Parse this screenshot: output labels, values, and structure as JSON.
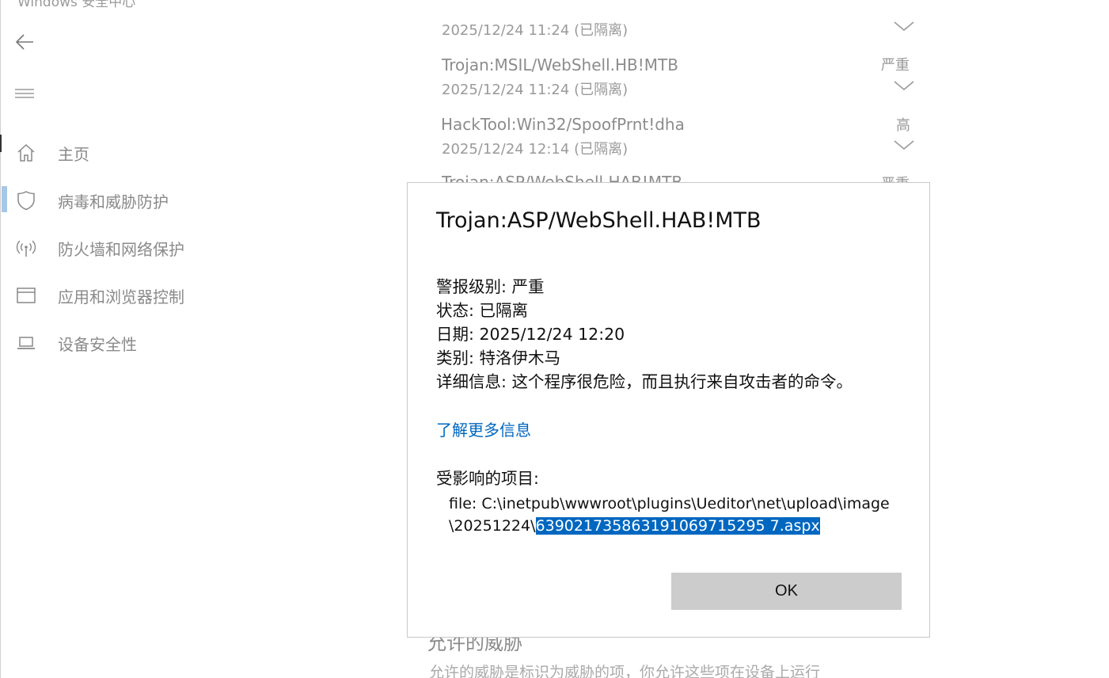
{
  "app": {
    "title": "Windows 安全中心"
  },
  "sidebar": {
    "items": [
      {
        "label": "主页",
        "icon": "home-icon"
      },
      {
        "label": "病毒和威胁防护",
        "icon": "shield-icon",
        "active": true
      },
      {
        "label": "防火墙和网络保护",
        "icon": "wireless-icon"
      },
      {
        "label": "应用和浏览器控制",
        "icon": "browser-window-icon"
      },
      {
        "label": "设备安全性",
        "icon": "laptop-icon"
      }
    ]
  },
  "threats": [
    {
      "name": "",
      "meta": "2025/12/24 11:24 (已隔离)",
      "severity": ""
    },
    {
      "name": "Trojan:MSIL/WebShell.HB!MTB",
      "meta": "2025/12/24 11:24 (已隔离)",
      "severity": "严重"
    },
    {
      "name": "HackTool:Win32/SpoofPrnt!dha",
      "meta": "2025/12/24 12:14 (已隔离)",
      "severity": "高"
    },
    {
      "name": "Trojan:ASP/WebShell.HAB!MTB",
      "meta": "",
      "severity": "严重"
    }
  ],
  "allowed_section": {
    "title": "允许的威胁",
    "description": "允许的威胁是标识为威胁的项，你允许这些项在设备上运行"
  },
  "dialog": {
    "title": "Trojan:ASP/WebShell.HAB!MTB",
    "alert_level_label": "警报级别:",
    "alert_level": "严重",
    "status_label": "状态:",
    "status": "已隔离",
    "date_label": "日期:",
    "date": "2025/12/24 12:20",
    "category_label": "类别:",
    "category": "特洛伊木马",
    "details_label": "详细信息:",
    "details": "这个程序很危险，而且执行来自攻击者的命令。",
    "learn_more": "了解更多信息",
    "affected_label": "受影响的项目:",
    "file_line1": "file: C:\\inetpub\\wwwroot\\plugins\\Ueditor\\net\\upload\\image",
    "file_line2_prefix": "\\20251224\\",
    "file_line2_selected": "639021735863191069715295 7.aspx",
    "ok_label": "OK"
  },
  "colors": {
    "accent": "#0067c0",
    "selection": "#0067c0",
    "ok_button": "#cccccc",
    "active_nav_bar": "#a7c7e7"
  }
}
